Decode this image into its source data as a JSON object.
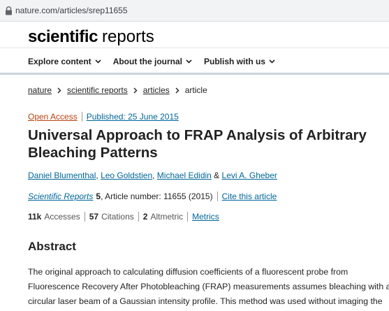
{
  "browser": {
    "url": "nature.com/articles/srep11655",
    "lock_icon": "lock-icon"
  },
  "site": {
    "brand_bold": "scientific",
    "brand_rest": "reports"
  },
  "nav": {
    "items": [
      {
        "label": "Explore content"
      },
      {
        "label": "About the journal"
      },
      {
        "label": "Publish with us"
      }
    ]
  },
  "breadcrumb": {
    "items": [
      "nature",
      "scientific reports",
      "articles"
    ],
    "current": "article"
  },
  "article": {
    "access": "Open Access",
    "published": "Published: 25 June 2015",
    "title": "Universal Approach to FRAP Analysis of Arbitrary Bleaching Patterns",
    "authors": [
      "Daniel Blumenthal",
      "Leo Goldstien",
      "Michael Edidin",
      "Levi A. Gheber"
    ],
    "author_sep": ", ",
    "author_and": " & ",
    "journal": "Scientific Reports",
    "volume": "5",
    "article_number": ", Article number: 11655 (2015)",
    "cite": "Cite this article",
    "accesses": "11k",
    "accesses_label": "Accesses",
    "citations": "57",
    "citations_label": "Citations",
    "altmetric": "2",
    "altmetric_label": "Altmetric",
    "metrics": "Metrics"
  },
  "abstract": {
    "heading": "Abstract",
    "text": "The original approach to calculating diffusion coefficients of a fluorescent probe from Fluorescence Recovery After Photobleaching (FRAP) measurements assumes bleaching with a circular laser beam of a Gaussian intensity profile. This method was used without imaging the"
  },
  "colors": {
    "link": "#006699",
    "open_access": "#b7410e",
    "nav_divider": "#cbd4da",
    "url_bar": "#f1f3f4"
  }
}
